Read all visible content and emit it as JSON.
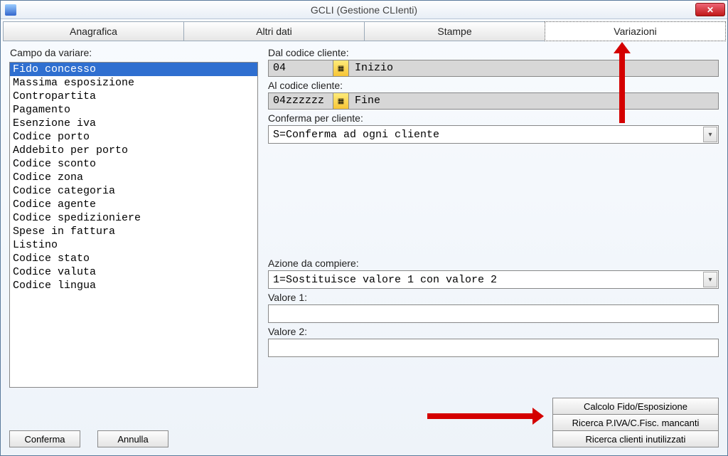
{
  "window": {
    "title": "GCLI (Gestione CLIenti)"
  },
  "tabs": [
    {
      "label": "Anagrafica"
    },
    {
      "label": "Altri dati"
    },
    {
      "label": "Stampe"
    },
    {
      "label": "Variazioni"
    }
  ],
  "active_tab_index": 3,
  "left": {
    "label": "Campo da variare:",
    "selected_index": 0,
    "items": [
      "Fido concesso",
      "Massima esposizione",
      "Contropartita",
      "Pagamento",
      "Esenzione iva",
      "Codice porto",
      "Addebito per porto",
      "Codice sconto",
      "Codice zona",
      "Codice categoria",
      "Codice agente",
      "Codice spedizioniere",
      "Spese in fattura",
      "Listino",
      "Codice stato",
      "Codice valuta",
      "Codice lingua"
    ]
  },
  "right": {
    "dal_label": "Dal codice cliente:",
    "dal_code": "04",
    "dal_desc": "Inizio",
    "al_label": "Al codice cliente:",
    "al_code": "04zzzzzz",
    "al_desc": "Fine",
    "conferma_label": "Conferma per cliente:",
    "conferma_value": "S=Conferma ad ogni cliente",
    "azione_label": "Azione da compiere:",
    "azione_value": "1=Sostituisce valore 1 con valore 2",
    "val1_label": "Valore 1:",
    "val1_value": "",
    "val2_label": "Valore 2:",
    "val2_value": ""
  },
  "buttons": {
    "calc_fido": "Calcolo Fido/Esposizione",
    "ricerca_pivacf": "Ricerca P.IVA/C.Fisc. mancanti",
    "ricerca_inutil": "Ricerca clienti inutilizzati",
    "conferma": "Conferma",
    "annulla": "Annulla"
  }
}
